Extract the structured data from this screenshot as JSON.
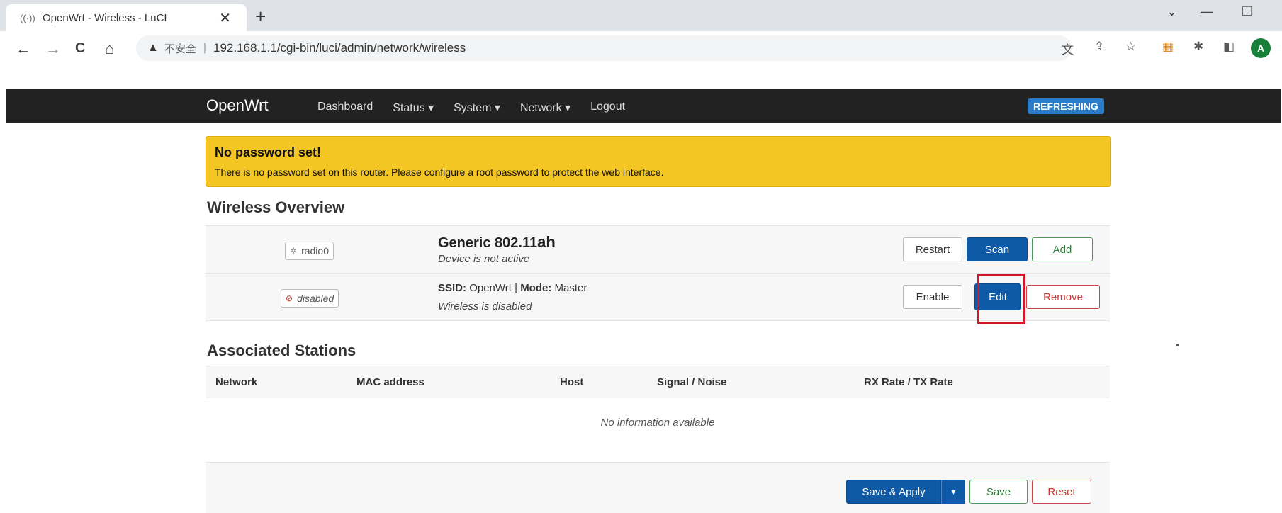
{
  "browser": {
    "tab_title": "OpenWrt - Wireless - LuCI",
    "tab_favicon": "((·))",
    "tab_close": "✕",
    "new_tab": "+",
    "window_controls": [
      "⌄",
      "—",
      "❐"
    ],
    "nav": {
      "back": "←",
      "forward": "→",
      "reload": "C",
      "home": "⌂"
    },
    "security_warning_icon": "▲",
    "security_label": "不安全",
    "address_separator": "|",
    "url": "192.168.1.1/cgi-bin/luci/admin/network/wireless",
    "profile_initial": "A",
    "icons": [
      "translate-icon",
      "share-icon",
      "star-icon",
      "extension-color-icon",
      "puzzle-icon",
      "sidepanel-icon"
    ]
  },
  "header": {
    "brand": "OpenWrt",
    "menu": [
      "Dashboard",
      "Status ▾",
      "System ▾",
      "Network ▾",
      "Logout"
    ],
    "badge": "REFRESHING"
  },
  "alert": {
    "title": "No password set!",
    "text": "There is no password set on this router. Please configure a root password to protect the web interface."
  },
  "wireless": {
    "title": "Wireless Overview",
    "device": {
      "badge": "radio0",
      "name": "Generic 802.11",
      "name_suffix": "ah",
      "status": "Device is not active",
      "buttons": [
        "Restart",
        "Scan",
        "Add"
      ]
    },
    "network": {
      "badge": "disabled",
      "ssid_label": "SSID:",
      "ssid": "OpenWrt",
      "divider": "|",
      "mode_label": "Mode:",
      "mode": "Master",
      "status": "Wireless is disabled",
      "buttons": [
        "Enable",
        "Edit",
        "Remove"
      ]
    }
  },
  "stations": {
    "title": "Associated Stations",
    "columns": [
      "Network",
      "MAC address",
      "Host",
      "Signal / Noise",
      "RX Rate / TX Rate"
    ],
    "empty": "No information available"
  },
  "footer": {
    "save_apply": "Save & Apply",
    "dropdown": "▾",
    "save": "Save",
    "reset": "Reset"
  },
  "colors": {
    "header_bg": "#222222",
    "alert_bg": "#f3c623",
    "primary": "#0e5aa7",
    "refresh_badge": "#2c7bc6",
    "highlight": "#d1182a"
  }
}
